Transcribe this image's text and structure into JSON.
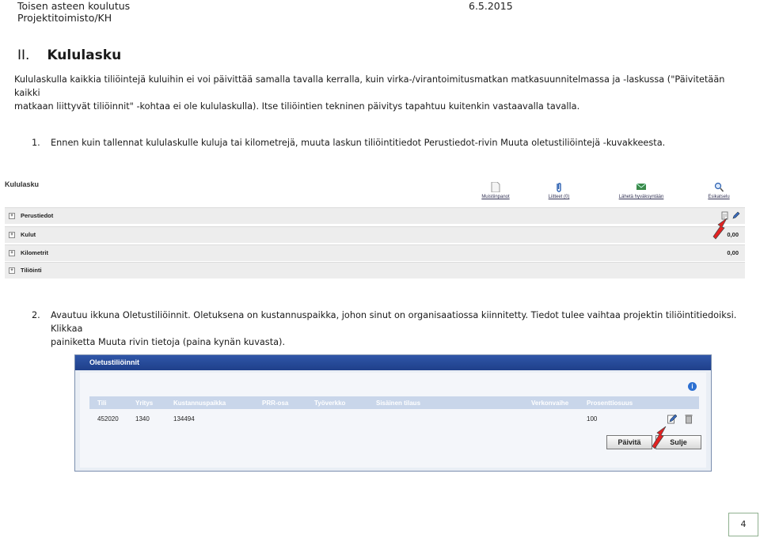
{
  "header": {
    "org": "Toisen asteen koulutus",
    "unit": "Projektitoimisto/KH",
    "date": "6.5.2015"
  },
  "section": {
    "number": "II.",
    "title": "Kululasku"
  },
  "intro": {
    "line1": "Kululaskulla kaikkia tiliöintejä kuluihin ei voi päivittää samalla tavalla kerralla, kuin virka-/virantoimitusmatkan matkasuunnitelmassa ja -laskussa (\"Päivitetään kaikki",
    "line2": "matkaan liittyvät tiliöinnit\" -kohtaa ei ole kululaskulla). Itse tiliöintien tekninen päivitys tapahtuu kuitenkin vastaavalla tavalla."
  },
  "steps": [
    {
      "num": "1.",
      "text": "Ennen kuin tallennat kululaskulle kuluja tai kilometrejä, muuta laskun tiliöintitiedot Perustiedot-rivin Muuta oletustiliöintejä -kuvakkeesta."
    },
    {
      "num": "2.",
      "line1": "Avautuu ikkuna Oletustiliöinnit. Oletuksena on kustannuspaikka, johon sinut on organisaatiossa kiinnitetty. Tiedot tulee vaihtaa projektin tiliöintitiedoiksi. Klikkaa",
      "line2": "painiketta Muuta rivin tietoja (paina kynän kuvasta)."
    }
  ],
  "screenshot1": {
    "title": "Kululasku",
    "toolbar": [
      "Muistiinpanot",
      "Liitteet (0)",
      "Lähetä hyväksyntään",
      "Esikatselu"
    ],
    "rows": [
      {
        "label": "Perustiedot",
        "value": ""
      },
      {
        "label": "Kulut",
        "value": "0,00"
      },
      {
        "label": "Kilometrit",
        "value": "0,00"
      },
      {
        "label": "Tiliöinti",
        "value": ""
      }
    ]
  },
  "screenshot2": {
    "title": "Oletustiliöinnit",
    "columns": [
      "Tili",
      "Yritys",
      "Kustannuspaikka",
      "PRR-osa",
      "Työverkko",
      "Sisäinen tilaus",
      "Verkonvaihe",
      "Prosenttiosuus"
    ],
    "row": [
      "452020",
      "1340",
      "134494",
      "",
      "",
      "",
      "",
      "100"
    ],
    "buttons": {
      "update": "Päivitä",
      "close": "Sulje"
    }
  },
  "page_number": "4",
  "colors": {
    "dialog_bar": "#2f56a8",
    "table_header": "#c9d6ea",
    "arrow": "#e32222"
  }
}
